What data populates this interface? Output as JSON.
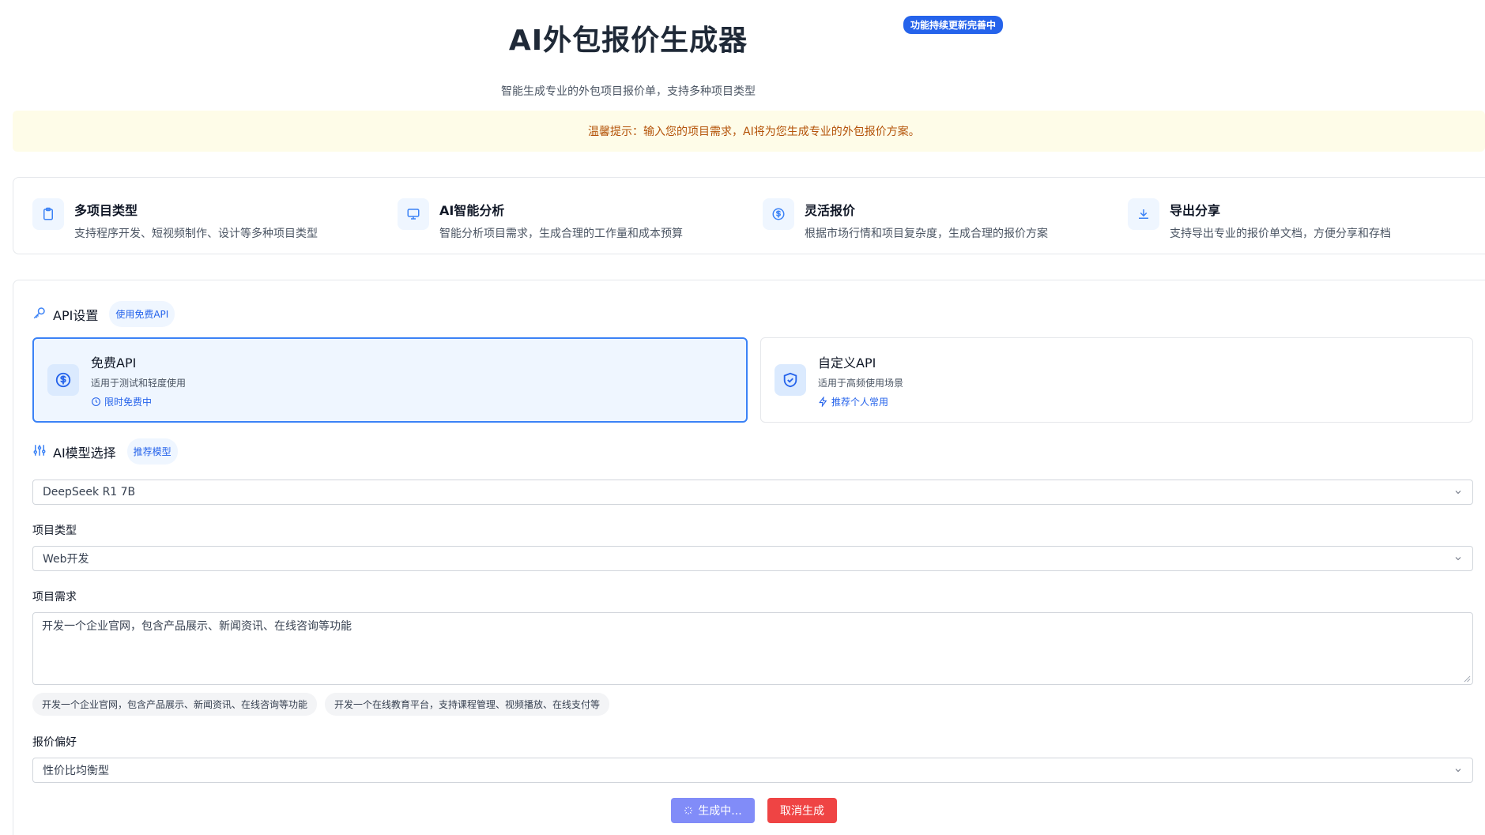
{
  "header": {
    "title": "AI外包报价生成器",
    "badge": "功能持续更新完善中",
    "subtitle": "智能生成专业的外包项目报价单，支持多种项目类型"
  },
  "tip": "温馨提示：输入您的项目需求，AI将为您生成专业的外包报价方案。",
  "features": [
    {
      "icon": "clipboard-icon",
      "title": "多项目类型",
      "desc": "支持程序开发、短视频制作、设计等多种项目类型"
    },
    {
      "icon": "monitor-icon",
      "title": "AI智能分析",
      "desc": "智能分析项目需求，生成合理的工作量和成本预算"
    },
    {
      "icon": "dollar-circle-icon",
      "title": "灵活报价",
      "desc": "根据市场行情和项目复杂度，生成合理的报价方案"
    },
    {
      "icon": "download-icon",
      "title": "导出分享",
      "desc": "支持导出专业的报价单文档，方便分享和存档"
    }
  ],
  "api_settings": {
    "title": "API设置",
    "pill": "使用免费API",
    "options": [
      {
        "icon": "dollar-circle-icon",
        "title": "免费API",
        "desc": "适用于测试和轻度使用",
        "hint_icon": "clock-icon",
        "hint": "限时免费中",
        "selected": true
      },
      {
        "icon": "shield-check-icon",
        "title": "自定义API",
        "desc": "适用于高频使用场景",
        "hint_icon": "lightning-icon",
        "hint": "推荐个人常用",
        "selected": false
      }
    ]
  },
  "model": {
    "title": "AI模型选择",
    "pill": "推荐模型",
    "selected": "DeepSeek R1 7B"
  },
  "project_type": {
    "label": "项目类型",
    "selected": "Web开发"
  },
  "requirements": {
    "label": "项目需求",
    "value": "开发一个企业官网，包含产品展示、新闻资讯、在线咨询等功能",
    "examples": [
      "开发一个企业官网，包含产品展示、新闻资讯、在线咨询等功能",
      "开发一个在线教育平台，支持课程管理、视频播放、在线支付等"
    ]
  },
  "preference": {
    "label": "报价偏好",
    "selected": "性价比均衡型"
  },
  "buttons": {
    "generate": "生成中...",
    "cancel": "取消生成"
  },
  "colors": {
    "accent": "#2563eb",
    "selected_bg": "#eff6ff",
    "tip_bg": "#fefce8",
    "tip_text": "#b45309",
    "generate_btn": "#818cf8",
    "cancel_btn": "#ef4444"
  }
}
